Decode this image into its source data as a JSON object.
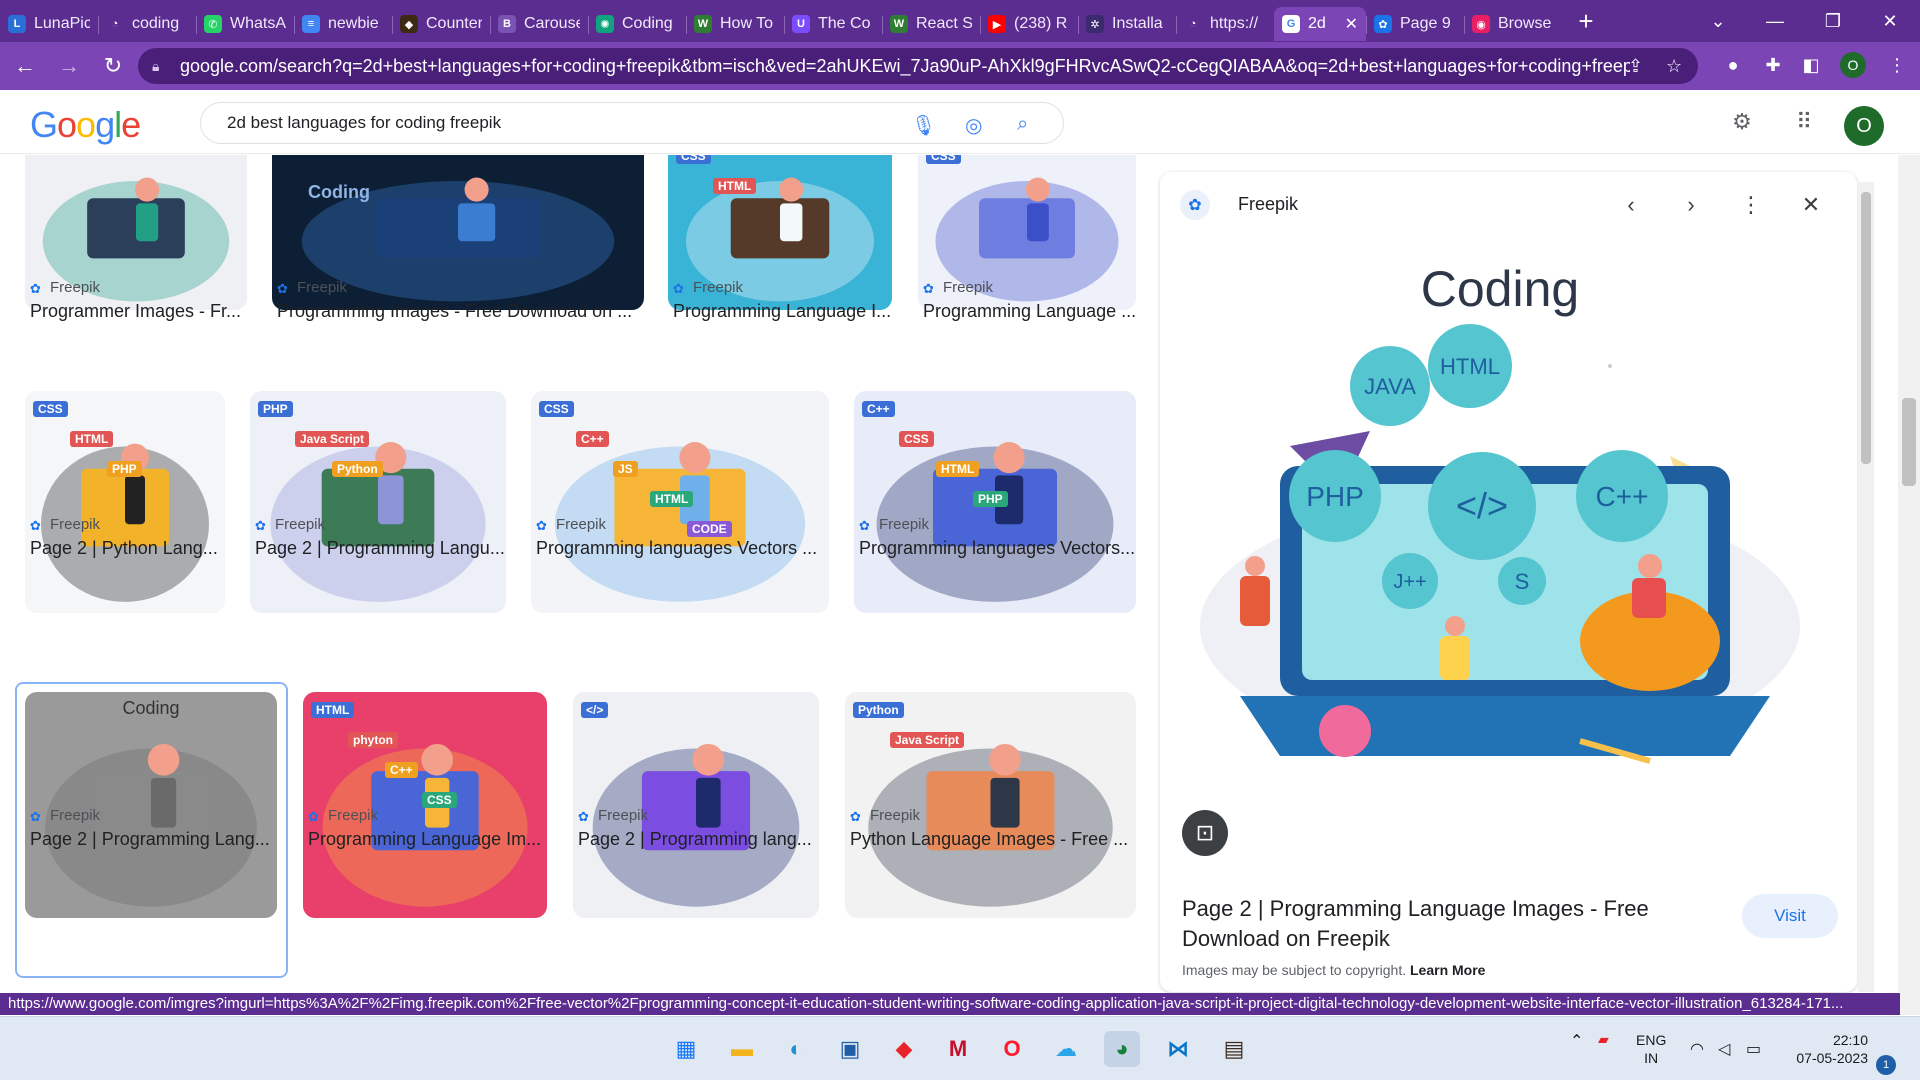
{
  "browser": {
    "tabs": [
      {
        "label": "LunaPic",
        "color": "#2a6fd6",
        "glyph": "L"
      },
      {
        "label": "coding",
        "color": "#5c2d91",
        "glyph": "◔"
      },
      {
        "label": "WhatsApp",
        "color": "#25d366",
        "glyph": "✆"
      },
      {
        "label": "newbie",
        "color": "#4285f4",
        "glyph": "≡"
      },
      {
        "label": "Counter",
        "color": "#3c2a14",
        "glyph": "◆"
      },
      {
        "label": "Carousel",
        "color": "#7952b3",
        "glyph": "B"
      },
      {
        "label": "Coding",
        "color": "#10a37f",
        "glyph": "✺"
      },
      {
        "label": "How To",
        "color": "#2e7d32",
        "glyph": "W"
      },
      {
        "label": "The Co",
        "color": "#7c4dff",
        "glyph": "U"
      },
      {
        "label": "React S",
        "color": "#2e7d32",
        "glyph": "W"
      },
      {
        "label": "(238) R",
        "color": "#ff0000",
        "glyph": "▶"
      },
      {
        "label": "Installa",
        "color": "#3b2a6e",
        "glyph": "✲"
      },
      {
        "label": "https://",
        "color": "#5c2d91",
        "glyph": "◔"
      },
      {
        "label": "2d",
        "color": "#ffffff",
        "glyph": "G",
        "active": true
      },
      {
        "label": "Page 9",
        "color": "#1a73e8",
        "glyph": "✿"
      },
      {
        "label": "Browse",
        "color": "#e91e63",
        "glyph": "◉"
      }
    ],
    "url": "google.com/search?q=2d+best+languages+for+coding+freepik&tbm=isch&ved=2ahUKEwi_7Ja90uP-AhXkl9gFHRvcASwQ2-cCegQIABAA&oq=2d+best+languages+for+coding+freepi...",
    "profile_initial": "O",
    "status_url": "https://www.google.com/imgres?imgurl=https%3A%2F%2Fimg.freepik.com%2Ffree-vector%2Fprogramming-concept-it-education-student-writing-software-coding-application-java-script-it-project-digital-technology-development-website-interface-vector-illustration_613284-171..."
  },
  "google": {
    "logo": "Google",
    "query": "2d best languages for coding freepik",
    "avatar_initial": "O"
  },
  "results": [
    {
      "source": "Freepik",
      "title": "Programmer Images - Fr..."
    },
    {
      "source": "Freepik",
      "title": "Programming Images - Free Download on ..."
    },
    {
      "source": "Freepik",
      "title": "Programming Language I..."
    },
    {
      "source": "Freepik",
      "title": "Programming Language ..."
    },
    {
      "source": "Freepik",
      "title": "Page 2 | Python Lang..."
    },
    {
      "source": "Freepik",
      "title": "Page 2 | Programming Langu..."
    },
    {
      "source": "Freepik",
      "title": "Programming languages Vectors ..."
    },
    {
      "source": "Freepik",
      "title": "Programming languages Vectors..."
    },
    {
      "source": "Freepik",
      "title": "Page 2 | Programming Lang...",
      "thumb_text": "Coding"
    },
    {
      "source": "Freepik",
      "title": "Programming Language Im..."
    },
    {
      "source": "Freepik",
      "title": "Page 2 | Programming lang..."
    },
    {
      "source": "Freepik",
      "title": "Python Language Images - Free ..."
    }
  ],
  "thumb_labels": {
    "coding_banner": "Coding",
    "tags": [
      "CSS",
      "HTML",
      "PHP",
      "C++",
      "JS",
      "JAVA",
      "CODE",
      "phyton",
      "</>",
      "Python",
      "Java Script"
    ]
  },
  "panel": {
    "source": "Freepik",
    "image_heading": "Coding",
    "image_tags": [
      "JAVA",
      "HTML",
      "PHP",
      "C++",
      "J++",
      "S",
      "</>"
    ],
    "title": "Page 2 | Programming Language Images - Free Download on Freepik",
    "visit_label": "Visit",
    "copyright_text": "Images may be subject to copyright.",
    "learn_more": "Learn More"
  },
  "taskbar": {
    "lang_top": "ENG",
    "lang_bottom": "IN",
    "time": "22:10",
    "date": "07-05-2023",
    "notification_count": "1"
  }
}
